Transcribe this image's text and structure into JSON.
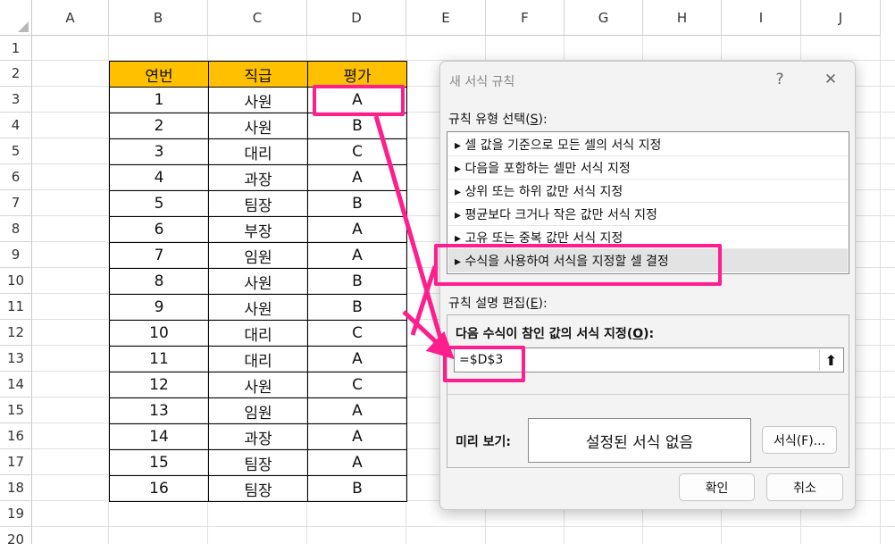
{
  "sheet": {
    "column_headers": [
      "A",
      "B",
      "C",
      "D",
      "E",
      "F",
      "G",
      "H",
      "I",
      "J"
    ],
    "row_headers": [
      "1",
      "2",
      "3",
      "4",
      "5",
      "6",
      "7",
      "8",
      "9",
      "10",
      "11",
      "12",
      "13",
      "14",
      "15",
      "16",
      "17",
      "18",
      "19",
      "20"
    ],
    "table_headers": [
      "연번",
      "직급",
      "평가"
    ],
    "rows": [
      [
        "1",
        "사원",
        "A"
      ],
      [
        "2",
        "사원",
        "B"
      ],
      [
        "3",
        "대리",
        "C"
      ],
      [
        "4",
        "과장",
        "A"
      ],
      [
        "5",
        "팀장",
        "B"
      ],
      [
        "6",
        "부장",
        "A"
      ],
      [
        "7",
        "임원",
        "A"
      ],
      [
        "8",
        "사원",
        "B"
      ],
      [
        "9",
        "사원",
        "B"
      ],
      [
        "10",
        "대리",
        "C"
      ],
      [
        "11",
        "대리",
        "A"
      ],
      [
        "12",
        "사원",
        "C"
      ],
      [
        "13",
        "임원",
        "A"
      ],
      [
        "14",
        "과장",
        "A"
      ],
      [
        "15",
        "팀장",
        "A"
      ],
      [
        "16",
        "팀장",
        "B"
      ]
    ],
    "header_fill": "#ffc000"
  },
  "dialog": {
    "title": "새 서식 규칙",
    "help_label": "?",
    "close_label": "✕",
    "rule_type_label": "규칙 유형 선택",
    "rule_type_key": "S",
    "rules": [
      "▸ 셀 값을 기준으로 모든 셀의 서식 지정",
      "▸ 다음을 포함하는 셀만 서식 지정",
      "▸ 상위 또는 하위 값만 서식 지정",
      "▸ 평균보다 크거나 작은 값만 서식 지정",
      "▸ 고유 또는 중복 값만 서식 지정",
      "▸ 수식을 사용하여 서식을 지정할 셀 결정"
    ],
    "selected_rule_index": 5,
    "edit_label": "규칙 설명 편집",
    "edit_key": "E",
    "formula_label": "다음 수식이 참인 값의 서식 지정",
    "formula_key": "O",
    "formula_value": "=$D$3",
    "preview_label": "미리 보기:",
    "preview_text": "설정된 서식 없음",
    "format_button": "서식(F)...",
    "ok_button": "확인",
    "cancel_button": "취소"
  },
  "highlight_color": "#ff1e8e"
}
